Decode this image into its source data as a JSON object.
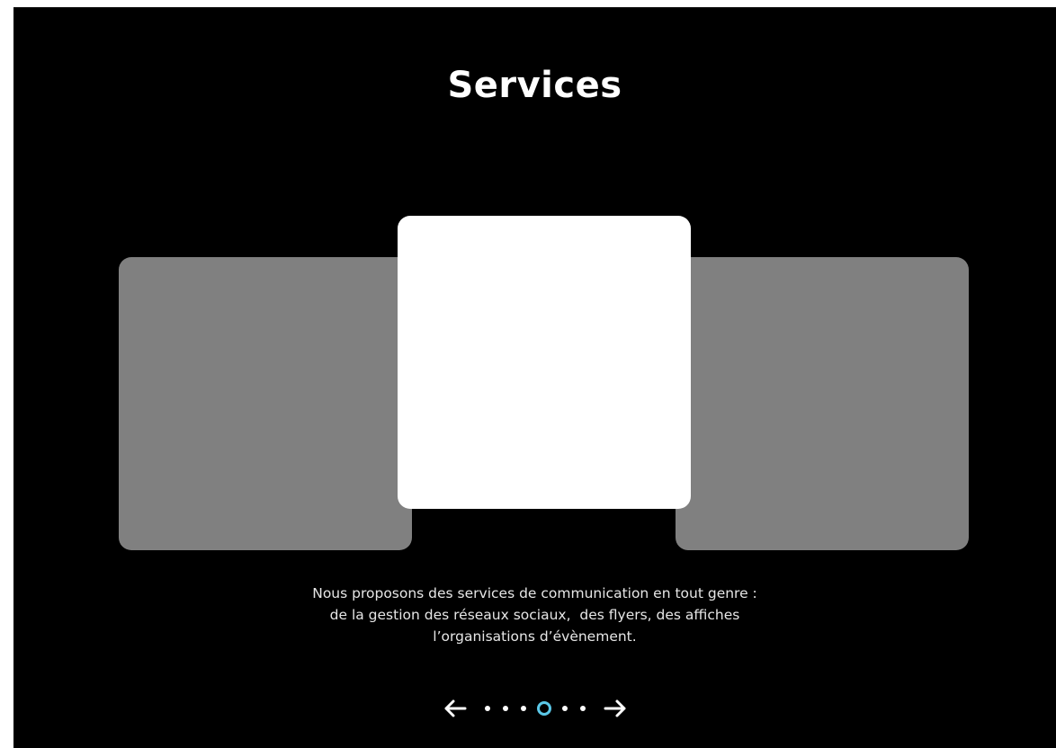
{
  "section": {
    "title": "Services"
  },
  "carousel": {
    "cards": [
      {
        "position": "left",
        "color": "#808080"
      },
      {
        "position": "center",
        "color": "#ffffff"
      },
      {
        "position": "right",
        "color": "#808080"
      }
    ],
    "description_lines": [
      "Nous proposons des services de communication en tout genre :",
      "de la gestion des réseaux sociaux,  des flyers, des affiches",
      "l’organisations d’évènement."
    ],
    "pagination": {
      "total": 6,
      "current": 4,
      "active_color": "#5bc8e8"
    },
    "icons": {
      "prev": "arrow-left-icon",
      "next": "arrow-right-icon"
    }
  },
  "colors": {
    "background": "#000000",
    "text": "#ffffff"
  }
}
